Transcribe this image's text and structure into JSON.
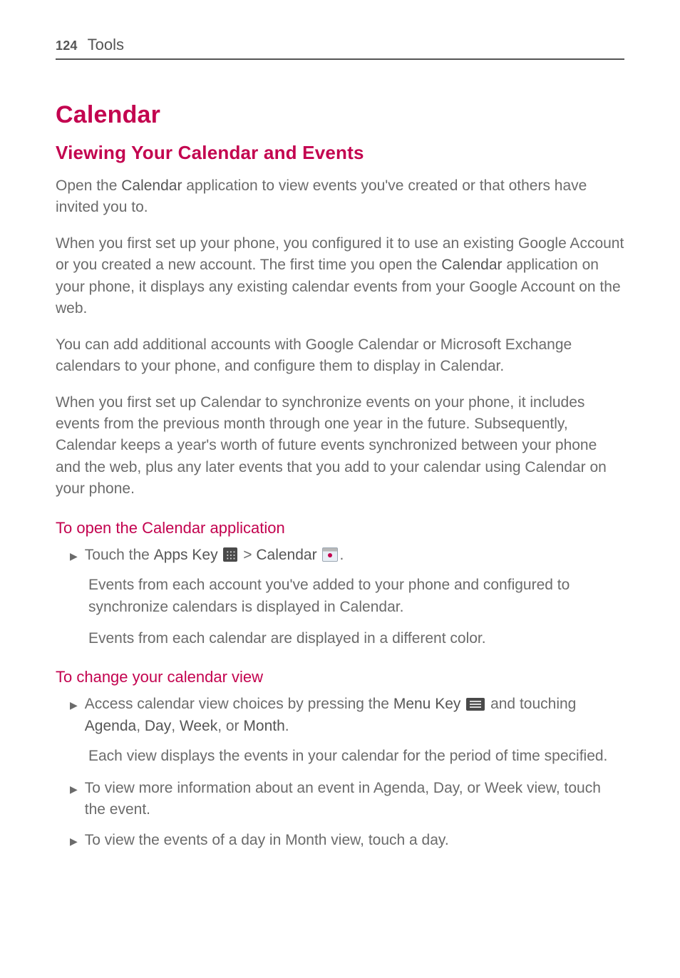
{
  "header": {
    "page_number": "124",
    "section": "Tools"
  },
  "h1": "Calendar",
  "h2": "Viewing Your Calendar and Events",
  "p1": {
    "a": "Open the ",
    "b": "Calendar",
    "c": " application to view events you've created or that others have invited you to."
  },
  "p2": {
    "a": "When you first set up your phone, you configured it to use an existing Google Account or you created a new account. The first time you open the ",
    "b": "Calendar",
    "c": " application on your phone, it displays any existing calendar events from your Google Account on the web."
  },
  "p3": "You can add additional accounts with Google Calendar or Microsoft Exchange calendars to your phone, and configure them to display in Calendar.",
  "p4": "When you first set up Calendar to synchronize events on your phone, it includes events from the previous month through one year in the future. Subsequently, Calendar keeps a year's worth of future events synchronized between your phone and the web, plus any later events that you add to your calendar using Calendar on your phone.",
  "h3a": "To open the Calendar application",
  "open_step": {
    "a": "Touch the ",
    "b": "Apps Key",
    "gt": " > ",
    "c": "Calendar",
    "d": "."
  },
  "open_sub1": "Events from each account you've added to your phone and configured to synchronize calendars is displayed in Calendar.",
  "open_sub2": "Events from each calendar are displayed in a different color.",
  "h3b": "To change your calendar view",
  "change_step": {
    "a": "Access calendar view choices by pressing the ",
    "b": "Menu Key",
    "c": " and touching ",
    "d": "Agenda",
    "sep1": ", ",
    "e": "Day",
    "sep2": ", ",
    "f": "Week",
    "sep3": ", or ",
    "g": "Month",
    "h": "."
  },
  "change_sub": "Each view displays the events in your calendar for the period of time specified.",
  "bullet2": "To view more information about an event in Agenda, Day, or Week view, touch the event.",
  "bullet3": "To view the events of a day in Month view, touch a day."
}
